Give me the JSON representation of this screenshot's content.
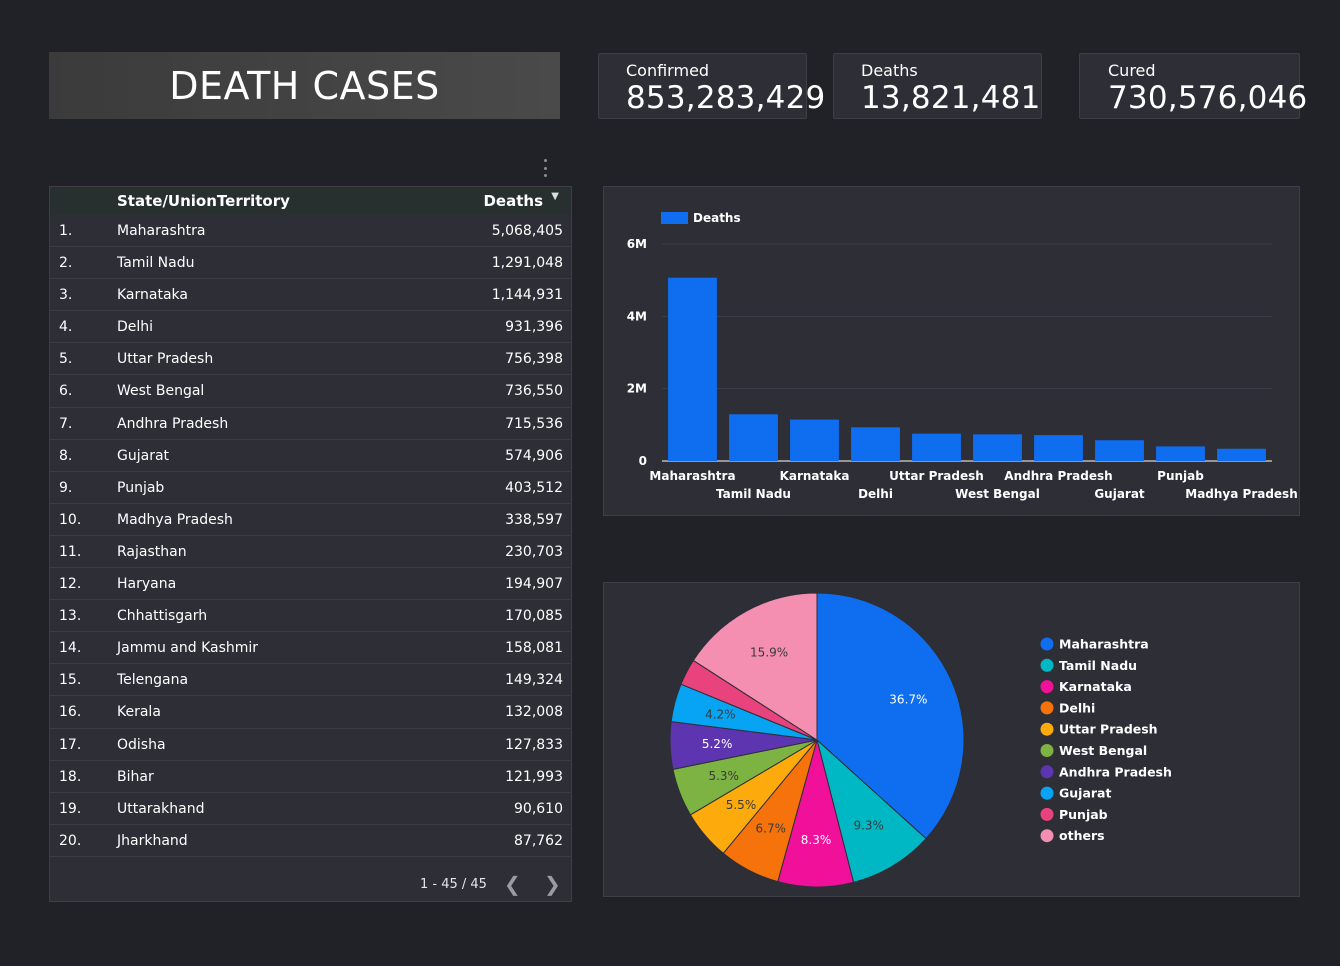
{
  "header": {
    "title": "DEATH CASES"
  },
  "kpis": {
    "confirmed": {
      "label": "Confirmed",
      "value": "853,283,429"
    },
    "deaths": {
      "label": "Deaths",
      "value": "13,821,481"
    },
    "cured": {
      "label": "Cured",
      "value": "730,576,046"
    }
  },
  "table": {
    "columns": {
      "state": "State/UnionTerritory",
      "deaths": "Deaths"
    },
    "rows": [
      {
        "idx": "1.",
        "name": "Maharashtra",
        "value": "5,068,405"
      },
      {
        "idx": "2.",
        "name": "Tamil Nadu",
        "value": "1,291,048"
      },
      {
        "idx": "3.",
        "name": "Karnataka",
        "value": "1,144,931"
      },
      {
        "idx": "4.",
        "name": "Delhi",
        "value": "931,396"
      },
      {
        "idx": "5.",
        "name": "Uttar Pradesh",
        "value": "756,398"
      },
      {
        "idx": "6.",
        "name": "West Bengal",
        "value": "736,550"
      },
      {
        "idx": "7.",
        "name": "Andhra Pradesh",
        "value": "715,536"
      },
      {
        "idx": "8.",
        "name": "Gujarat",
        "value": "574,906"
      },
      {
        "idx": "9.",
        "name": "Punjab",
        "value": "403,512"
      },
      {
        "idx": "10.",
        "name": "Madhya Pradesh",
        "value": "338,597"
      },
      {
        "idx": "11.",
        "name": "Rajasthan",
        "value": "230,703"
      },
      {
        "idx": "12.",
        "name": "Haryana",
        "value": "194,907"
      },
      {
        "idx": "13.",
        "name": "Chhattisgarh",
        "value": "170,085"
      },
      {
        "idx": "14.",
        "name": "Jammu and Kashmir",
        "value": "158,081"
      },
      {
        "idx": "15.",
        "name": "Telengana",
        "value": "149,324"
      },
      {
        "idx": "16.",
        "name": "Kerala",
        "value": "132,008"
      },
      {
        "idx": "17.",
        "name": "Odisha",
        "value": "127,833"
      },
      {
        "idx": "18.",
        "name": "Bihar",
        "value": "121,993"
      },
      {
        "idx": "19.",
        "name": "Uttarakhand",
        "value": "90,610"
      },
      {
        "idx": "20.",
        "name": "Jharkhand",
        "value": "87,762"
      }
    ],
    "pagination": "1 - 45 / 45"
  },
  "icons": {
    "prev": "chevron-left-icon",
    "next": "chevron-right-icon",
    "sort": "sort-desc-icon",
    "menu": "kebab-menu-icon"
  },
  "chart_data": [
    {
      "type": "bar",
      "title": "",
      "xlabel": "",
      "ylabel": "",
      "legend": "top-left",
      "ylim": [
        0,
        6000000
      ],
      "yticks": [
        "0",
        "2M",
        "4M",
        "6M"
      ],
      "categories": [
        "Maharashtra",
        "Tamil Nadu",
        "Karnataka",
        "Delhi",
        "Uttar Pradesh",
        "West Bengal",
        "Andhra Pradesh",
        "Gujarat",
        "Punjab",
        "Madhya Pradesh"
      ],
      "series": [
        {
          "name": "Deaths",
          "color": "#0f6ef0",
          "values": [
            5068405,
            1291048,
            1144931,
            931396,
            756398,
            736550,
            715536,
            574906,
            403512,
            338597
          ]
        }
      ],
      "grid": true
    },
    {
      "type": "pie",
      "title": "",
      "legend": "right",
      "slices": [
        {
          "label": "Maharashtra",
          "value": 36.7,
          "display": "36.7%",
          "color": "#0f6ef0"
        },
        {
          "label": "Tamil Nadu",
          "value": 9.3,
          "display": "9.3%",
          "color": "#00b8c4"
        },
        {
          "label": "Karnataka",
          "value": 8.3,
          "display": "8.3%",
          "color": "#f0109a"
        },
        {
          "label": "Delhi",
          "value": 6.7,
          "display": "6.7%",
          "color": "#f5730a"
        },
        {
          "label": "Uttar Pradesh",
          "value": 5.5,
          "display": "5.5%",
          "color": "#fdaa0c"
        },
        {
          "label": "West Bengal",
          "value": 5.3,
          "display": "5.3%",
          "color": "#7cb342"
        },
        {
          "label": "Andhra Pradesh",
          "value": 5.2,
          "display": "5.2%",
          "color": "#5e35b1"
        },
        {
          "label": "Gujarat",
          "value": 4.2,
          "display": "4.2%",
          "color": "#06a4f2"
        },
        {
          "label": "Punjab",
          "value": 2.9,
          "display": "",
          "color": "#e8437c"
        },
        {
          "label": "others",
          "value": 15.9,
          "display": "15.9%",
          "color": "#f48fb1"
        }
      ]
    }
  ]
}
